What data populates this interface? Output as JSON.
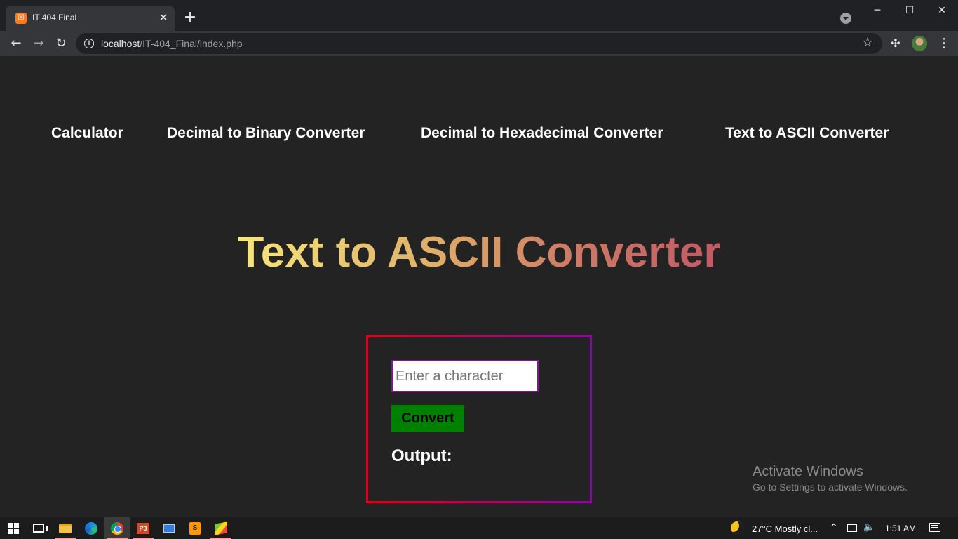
{
  "browser": {
    "tab_title": "IT 404 Final",
    "favicon_text": "☒",
    "url_host": "localhost",
    "url_path": "/IT-404_Final/index.php"
  },
  "nav": {
    "links": [
      "Calculator",
      "Decimal to Binary Converter",
      "Decimal to Hexadecimal Converter",
      "Text to ASCII Converter"
    ]
  },
  "main": {
    "title": "Text to ASCII Converter",
    "input_placeholder": "Enter a character",
    "input_value": "",
    "button_label": "Convert",
    "output_label": "Output:",
    "output_value": ""
  },
  "watermark": {
    "title": "Activate Windows",
    "subtitle": "Go to Settings to activate Windows."
  },
  "taskbar": {
    "ppt_label": "P3",
    "sublime_label": "S",
    "weather": "27°C  Mostly cl...",
    "time": "1:51 AM"
  },
  "colors": {
    "page_background": "#232323",
    "title_gradient": [
      "#f7e67d",
      "#e2b76b",
      "#cc7a66",
      "#c05a66"
    ],
    "box_border_gradient": [
      "#e0001a",
      "#8a0a9a"
    ],
    "convert_button": "#008000",
    "input_border": "#7a1a86"
  }
}
